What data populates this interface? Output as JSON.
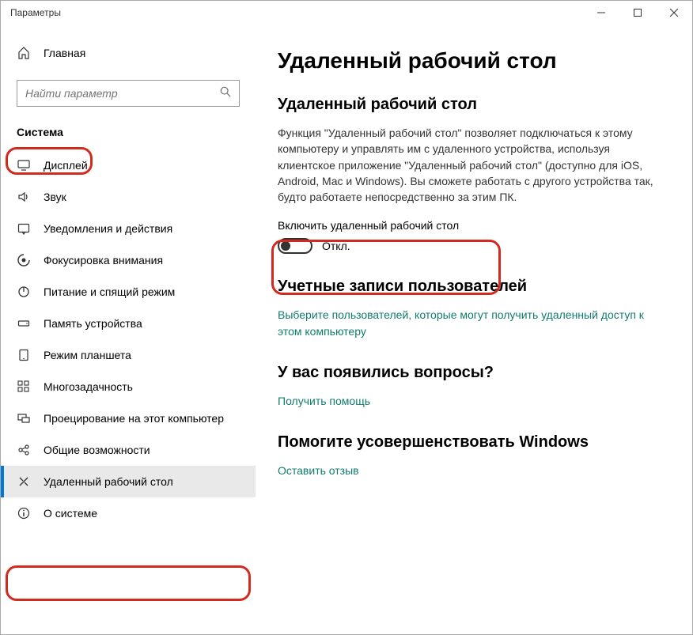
{
  "window": {
    "title": "Параметры"
  },
  "sidebar": {
    "home": "Главная",
    "search_placeholder": "Найти параметр",
    "section": "Система",
    "items": [
      {
        "label": "Дисплей"
      },
      {
        "label": "Звук"
      },
      {
        "label": "Уведомления и действия"
      },
      {
        "label": "Фокусировка внимания"
      },
      {
        "label": "Питание и спящий режим"
      },
      {
        "label": "Память устройства"
      },
      {
        "label": "Режим планшета"
      },
      {
        "label": "Многозадачность"
      },
      {
        "label": "Проецирование на этот компьютер"
      },
      {
        "label": "Общие возможности"
      },
      {
        "label": "Удаленный рабочий стол"
      },
      {
        "label": "О системе"
      }
    ]
  },
  "main": {
    "title": "Удаленный рабочий стол",
    "section1_title": "Удаленный рабочий стол",
    "description": "Функция \"Удаленный рабочий стол\" позволяет подключаться к этому компьютеру и управлять им с удаленного устройства, используя клиентское приложение \"Удаленный рабочий стол\" (доступно для iOS, Android, Mac и Windows). Вы сможете работать с другого устройства так, будто работаете непосредственно за этим ПК.",
    "toggle_label": "Включить удаленный рабочий стол",
    "toggle_state": "Откл.",
    "accounts_title": "Учетные записи пользователей",
    "accounts_link": "Выберите пользователей, которые могут получить удаленный доступ к этом компьютеру",
    "questions_title": "У вас появились вопросы?",
    "questions_link": "Получить помощь",
    "improve_title": "Помогите усовершенствовать Windows",
    "improve_link": "Оставить отзыв"
  }
}
